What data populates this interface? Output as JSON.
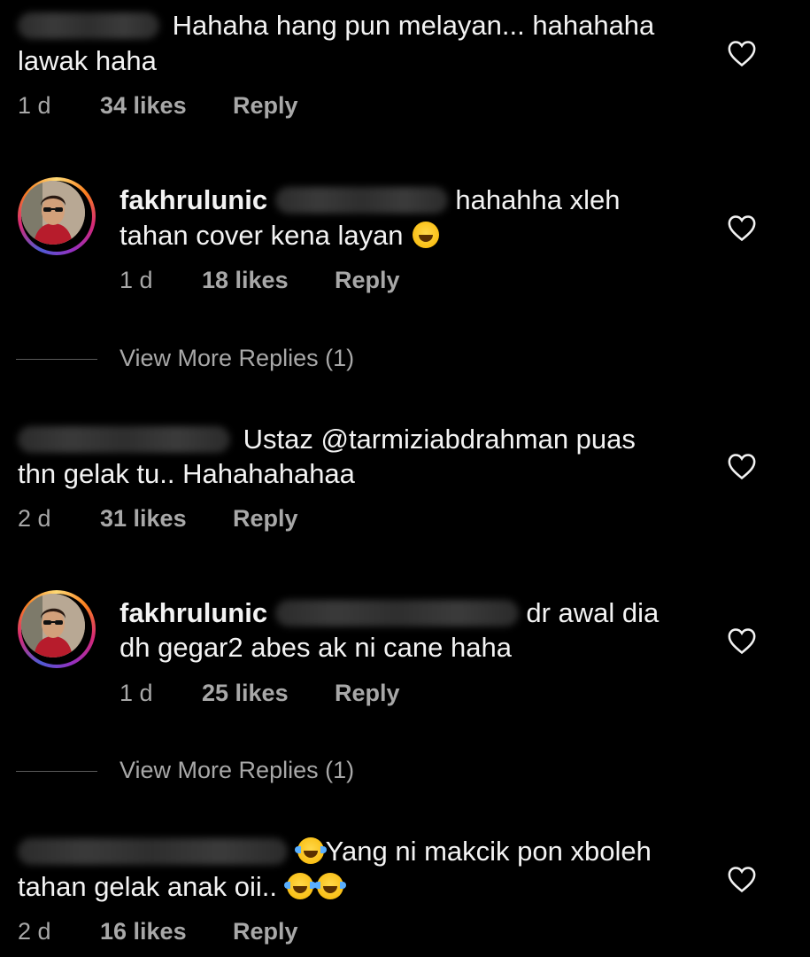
{
  "comments": [
    {
      "line1": "Hahaha hang pun melayan... hahahaha",
      "line2": "lawak haha",
      "time": "1 d",
      "likes": "34 likes",
      "reply": "Reply"
    },
    {
      "username": "fakhrulunic",
      "line1_after": "hahahha xleh",
      "line2": "tahan cover kena layan",
      "emoji": "grinning-squinting-face",
      "time": "1 d",
      "likes": "18 likes",
      "reply": "Reply"
    },
    {
      "line1": "Ustaz @tarmiziabdrahman puas",
      "line2": "thn gelak tu.. Hahahahahaa",
      "time": "2 d",
      "likes": "31 likes",
      "reply": "Reply"
    },
    {
      "username": "fakhrulunic",
      "line1_after": "dr awal dia",
      "line2": "dh gegar2 abes ak ni cane haha",
      "time": "1 d",
      "likes": "25 likes",
      "reply": "Reply"
    },
    {
      "line1": "Yang ni makcik pon xboleh",
      "line2": "tahan gelak anak oii..",
      "emoji": "face-with-tears-of-joy",
      "time": "2 d",
      "likes": "16 likes",
      "reply": "Reply"
    }
  ],
  "view_more_1": "View More Replies (1)",
  "view_more_2": "View More Replies (1)",
  "icons": {
    "like": "heart-outline-icon"
  },
  "colors": {
    "background": "#000000",
    "text": "#f3f3f3",
    "meta": "#a8a8a8"
  }
}
